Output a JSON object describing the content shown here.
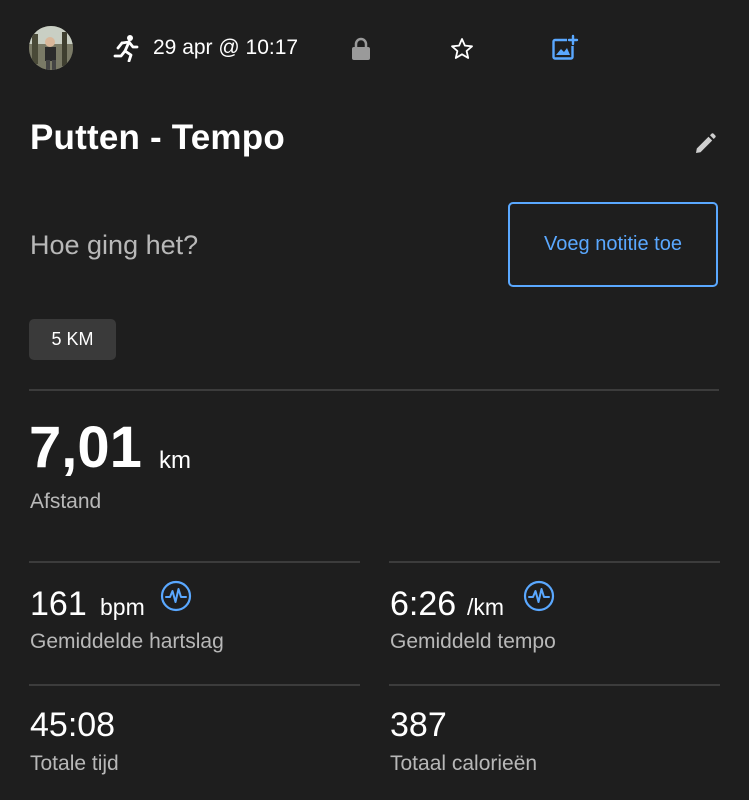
{
  "header": {
    "date_time": "29 apr @ 10:17",
    "avatar_icon": "user-avatar",
    "activity_icon": "running-icon",
    "lock_icon": "lock-icon",
    "star_icon": "star-outline-icon",
    "add_photo_icon": "add-photo-icon"
  },
  "activity": {
    "title": "Putten - Tempo",
    "edit_icon": "pencil-icon"
  },
  "note": {
    "prompt": "Hoe ging het?",
    "button_label": "Voeg notitie toe"
  },
  "tag": {
    "label": "5 KM"
  },
  "distance": {
    "value": "7,01",
    "unit": "km",
    "label": "Afstand"
  },
  "stats": {
    "heart_rate": {
      "value": "161",
      "unit": "bpm",
      "label": "Gemiddelde hartslag",
      "icon": "pulse-icon"
    },
    "pace": {
      "value": "6:26",
      "unit": "/km",
      "label": "Gemiddeld tempo",
      "icon": "pulse-icon"
    },
    "total_time": {
      "value": "45:08",
      "label": "Totale tijd"
    },
    "calories": {
      "value": "387",
      "label": "Totaal calorieën"
    }
  },
  "colors": {
    "background": "#1e1e1e",
    "accent": "#5aa8ff",
    "muted_text": "#b8b8b8",
    "icon_gray": "#9a9a9a"
  }
}
